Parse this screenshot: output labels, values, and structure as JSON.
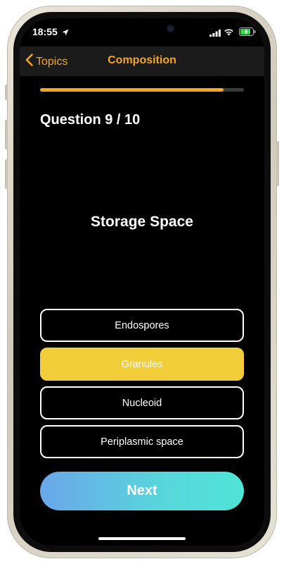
{
  "status_bar": {
    "time": "18:55",
    "location_icon": "location-arrow-icon",
    "signal_icon": "cell-signal-icon",
    "wifi_icon": "wifi-icon",
    "battery_icon": "battery-charging-icon"
  },
  "nav": {
    "back_label": "Topics",
    "title": "Composition",
    "accent": "#f5a623"
  },
  "quiz": {
    "progress": 0.9,
    "question_label": "Question 9 / 10",
    "prompt": "Storage Space",
    "answers": [
      {
        "label": "Endospores",
        "selected": false
      },
      {
        "label": "Granules",
        "selected": true
      },
      {
        "label": "Nucleoid",
        "selected": false
      },
      {
        "label": "Periplasmic space",
        "selected": false
      }
    ],
    "selected_color": "#f2cd3a",
    "next_label": "Next"
  }
}
